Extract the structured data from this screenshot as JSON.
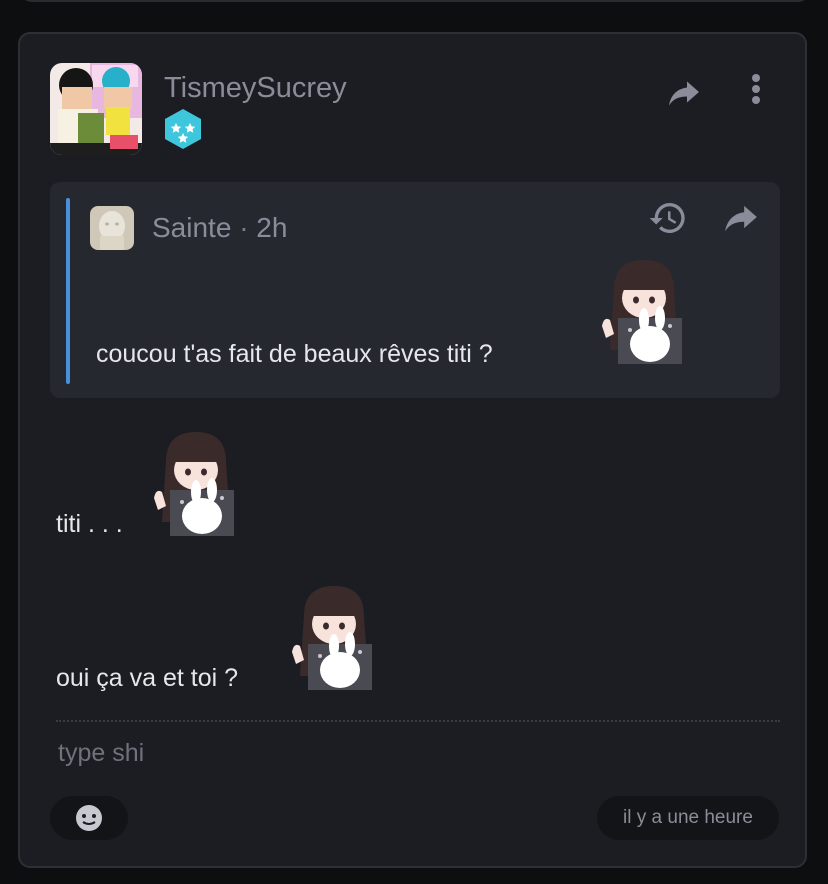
{
  "post": {
    "author": "TismeySucrey",
    "icons": {
      "share": "share-icon",
      "more": "more-vertical-icon",
      "badge": "hexagon-stars-badge-icon"
    }
  },
  "quote": {
    "author": "Sainte",
    "separator": "·",
    "time": "2h",
    "text": "coucou t'as fait de beaux rêves titi ?",
    "icons": {
      "history": "history-icon",
      "share": "share-icon"
    }
  },
  "messages": [
    {
      "text": "titi . . ."
    },
    {
      "text": "oui ça va et toi ?"
    }
  ],
  "composer": {
    "placeholder": "type shi",
    "emoji_icon": "emoji-face-icon",
    "timestamp": "il y a une heure"
  },
  "colors": {
    "accent": "#4a8fd9",
    "badge": "#3ec6dd",
    "background": "#1c1d22",
    "quote_background": "#262830"
  }
}
